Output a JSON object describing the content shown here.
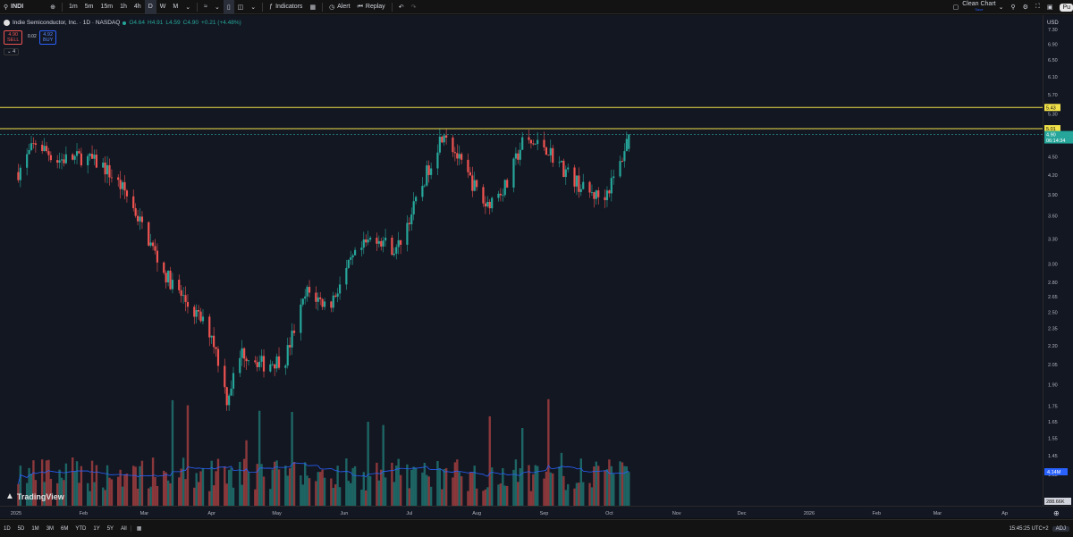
{
  "toolbar": {
    "symbol": "INDI",
    "intervals": [
      "1m",
      "5m",
      "15m",
      "1h",
      "4h",
      "D",
      "W",
      "M"
    ],
    "active_interval": "D",
    "indicators_label": "Indicators",
    "alert_label": "Alert",
    "replay_label": "Replay",
    "clean_chart_label": "Clean Chart",
    "clean_chart_sub": "Save",
    "publish_label": "Pu"
  },
  "legend": {
    "title": "Indie Semiconductor, Inc. · 1D · NASDAQ",
    "o": "O4.64",
    "h": "H4.91",
    "l": "L4.59",
    "c": "C4.90",
    "change": "+0.21 (+4.48%)",
    "sell_price": "4.90",
    "sell_label": "SELL",
    "buy_price": "4.92",
    "buy_label": "BUY",
    "spread": "0.02",
    "collapsed_count": "4"
  },
  "price_scale": {
    "currency": "USD",
    "ticks": [
      "7.30",
      "6.90",
      "6.50",
      "6.10",
      "5.70",
      "5.30",
      "4.50",
      "4.20",
      "3.90",
      "3.60",
      "3.30",
      "3.00",
      "2.80",
      "2.65",
      "2.50",
      "2.35",
      "2.20",
      "2.05",
      "1.90",
      "1.75",
      "1.65",
      "1.55",
      "1.45",
      "1.35",
      "1.22"
    ],
    "hline_upper_label": "5.43",
    "hline_lower_label": "5.01",
    "price_tag": "4.90",
    "countdown": "06:14:34",
    "vol_ma_tag": "4.14M",
    "vol_tag": "288.66K"
  },
  "time_axis": {
    "labels": [
      "2025",
      "Feb",
      "Mar",
      "Apr",
      "May",
      "Jun",
      "Jul",
      "Aug",
      "Sep",
      "Oct",
      "Nov",
      "Dec",
      "2026",
      "Feb",
      "Mar",
      "Ap"
    ]
  },
  "bottom_bar": {
    "ranges": [
      "1D",
      "5D",
      "1M",
      "3M",
      "6M",
      "YTD",
      "1Y",
      "5Y",
      "All"
    ],
    "clock": "15:45:25 UTC+2",
    "adj_label": "ADJ"
  },
  "watermark": "TradingView",
  "colors": {
    "up": "#26a69a",
    "down": "#ef5350",
    "hline": "#f0e14a",
    "vol_ma": "#2962ff",
    "accent": "#2962ff"
  },
  "chart_data": {
    "type": "candlestick",
    "title": "Indie Semiconductor, Inc. · 1D · NASDAQ",
    "y_range": [
      1.2,
      7.6
    ],
    "horizontal_lines": [
      5.43,
      5.01
    ],
    "last_price": 4.9,
    "path": [
      {
        "date": "2025-01-02",
        "close": 4.25
      },
      {
        "date": "2025-01-10",
        "close": 4.75
      },
      {
        "date": "2025-01-20",
        "close": 4.45
      },
      {
        "date": "2025-02-01",
        "close": 4.5
      },
      {
        "date": "2025-02-10",
        "close": 4.35
      },
      {
        "date": "2025-02-20",
        "close": 3.95
      },
      {
        "date": "2025-03-01",
        "close": 3.4
      },
      {
        "date": "2025-03-10",
        "close": 2.9
      },
      {
        "date": "2025-03-20",
        "close": 2.6
      },
      {
        "date": "2025-04-01",
        "close": 2.3
      },
      {
        "date": "2025-04-08",
        "close": 1.8
      },
      {
        "date": "2025-04-15",
        "close": 2.15
      },
      {
        "date": "2025-04-25",
        "close": 2.05
      },
      {
        "date": "2025-05-05",
        "close": 2.1
      },
      {
        "date": "2025-05-15",
        "close": 2.7
      },
      {
        "date": "2025-05-25",
        "close": 2.55
      },
      {
        "date": "2025-06-05",
        "close": 3.05
      },
      {
        "date": "2025-06-15",
        "close": 3.35
      },
      {
        "date": "2025-06-25",
        "close": 3.15
      },
      {
        "date": "2025-07-05",
        "close": 3.85
      },
      {
        "date": "2025-07-17",
        "close": 5.0
      },
      {
        "date": "2025-07-25",
        "close": 4.35
      },
      {
        "date": "2025-08-05",
        "close": 3.75
      },
      {
        "date": "2025-08-15",
        "close": 4.05
      },
      {
        "date": "2025-08-22",
        "close": 4.75
      },
      {
        "date": "2025-09-01",
        "close": 4.7
      },
      {
        "date": "2025-09-10",
        "close": 4.3
      },
      {
        "date": "2025-09-20",
        "close": 3.95
      },
      {
        "date": "2025-09-28",
        "close": 3.85
      },
      {
        "date": "2025-10-05",
        "close": 4.25
      },
      {
        "date": "2025-10-10",
        "close": 4.9
      }
    ]
  }
}
